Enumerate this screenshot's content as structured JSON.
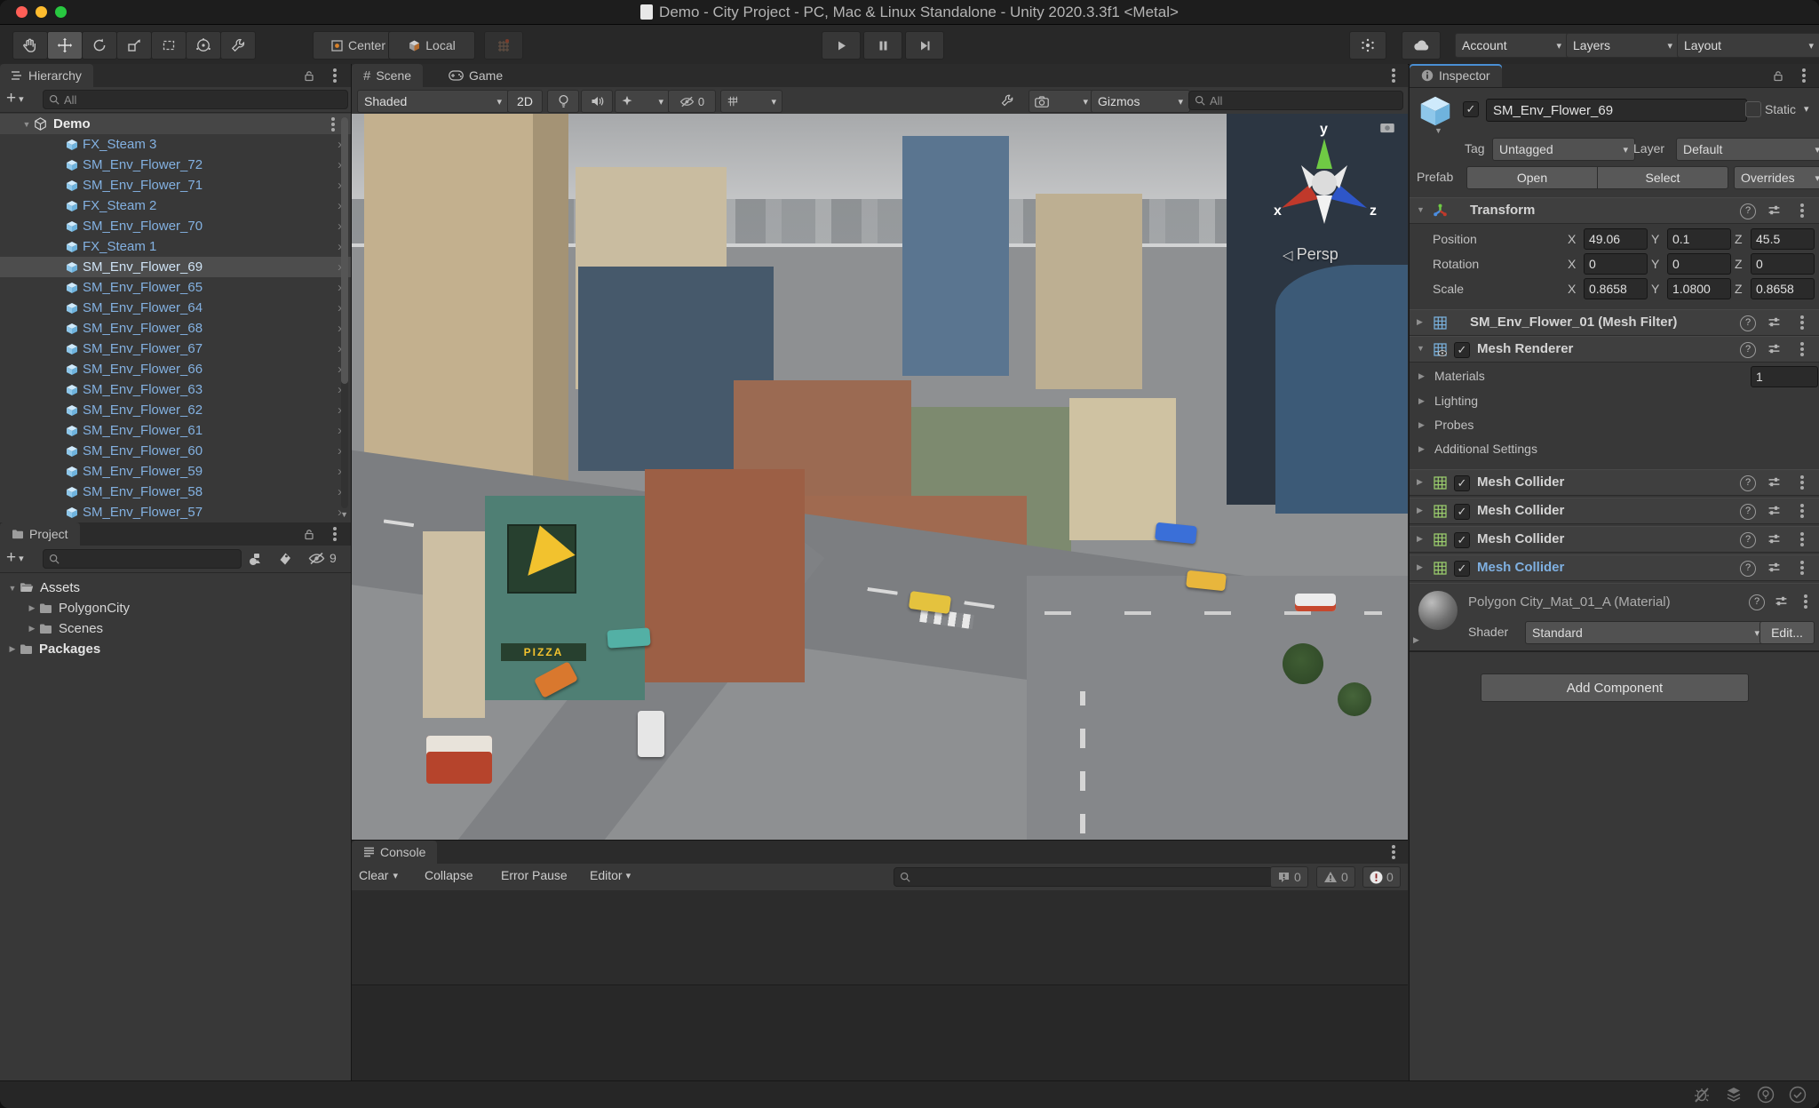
{
  "window": {
    "title": "Demo - City Project - PC, Mac & Linux Standalone - Unity 2020.3.3f1 <Metal>"
  },
  "toolbar": {
    "pivot_label": "Center",
    "orientation_label": "Local",
    "account_label": "Account",
    "layers_label": "Layers",
    "layout_label": "Layout"
  },
  "hierarchy": {
    "tab_label": "Hierarchy",
    "search_placeholder": "All",
    "root_label": "Demo",
    "selected_item": "SM_Env_Flower_69",
    "items": [
      "FX_Steam 3",
      "SM_Env_Flower_72",
      "SM_Env_Flower_71",
      "FX_Steam 2",
      "SM_Env_Flower_70",
      "FX_Steam 1",
      "SM_Env_Flower_69",
      "SM_Env_Flower_65",
      "SM_Env_Flower_64",
      "SM_Env_Flower_68",
      "SM_Env_Flower_67",
      "SM_Env_Flower_66",
      "SM_Env_Flower_63",
      "SM_Env_Flower_62",
      "SM_Env_Flower_61",
      "SM_Env_Flower_60",
      "SM_Env_Flower_59",
      "SM_Env_Flower_58",
      "SM_Env_Flower_57"
    ]
  },
  "project": {
    "tab_label": "Project",
    "hidden_count": "9",
    "items": [
      "Assets",
      "PolygonCity",
      "Scenes",
      "Packages"
    ]
  },
  "scene": {
    "tab_scene": "Scene",
    "tab_game": "Game",
    "draw_mode": "Shaded",
    "btn_2d": "2D",
    "hidden_count": "0",
    "gizmos_label": "Gizmos",
    "search_placeholder": "All",
    "camera_label": "Persp",
    "axis": {
      "x": "x",
      "y": "y",
      "z": "z"
    },
    "signs": {
      "pizza": "PIZZA"
    }
  },
  "console": {
    "tab_label": "Console",
    "clear_label": "Clear",
    "collapse_label": "Collapse",
    "error_pause_label": "Error Pause",
    "editor_label": "Editor",
    "info_count": "0",
    "warning_count": "0",
    "error_count": "0"
  },
  "inspector": {
    "tab_label": "Inspector",
    "header": {
      "name": "SM_Env_Flower_69",
      "static_label": "Static",
      "tag_label": "Tag",
      "tag_value": "Untagged",
      "layer_label": "Layer",
      "layer_value": "Default",
      "prefab_label": "Prefab",
      "open_label": "Open",
      "select_label": "Select",
      "overrides_label": "Overrides"
    },
    "transform": {
      "title": "Transform",
      "axis": {
        "x": "X",
        "y": "Y",
        "z": "Z"
      },
      "rows": [
        {
          "label": "Position",
          "x": "49.06",
          "y": "0.1",
          "z": "45.5"
        },
        {
          "label": "Rotation",
          "x": "0",
          "y": "0",
          "z": "0"
        },
        {
          "label": "Scale",
          "x": "0.8658",
          "y": "1.0800",
          "z": "0.8658"
        }
      ]
    },
    "mesh_filter_title": "SM_Env_Flower_01 (Mesh Filter)",
    "mesh_renderer": {
      "title": "Mesh Renderer",
      "materials_label": "Materials",
      "materials_count": "1",
      "lighting_label": "Lighting",
      "probes_label": "Probes",
      "additional_label": "Additional Settings"
    },
    "mesh_colliders": [
      "Mesh Collider",
      "Mesh Collider",
      "Mesh Collider",
      "Mesh Collider"
    ],
    "material": {
      "title": "Polygon City_Mat_01_A (Material)",
      "shader_label": "Shader",
      "shader_value": "Standard",
      "edit_label": "Edit..."
    },
    "add_component_label": "Add Component"
  },
  "colors": {
    "accent": "#4a8fd4",
    "prefab_text": "#83b1e1",
    "selection": "#4d4d4d"
  }
}
